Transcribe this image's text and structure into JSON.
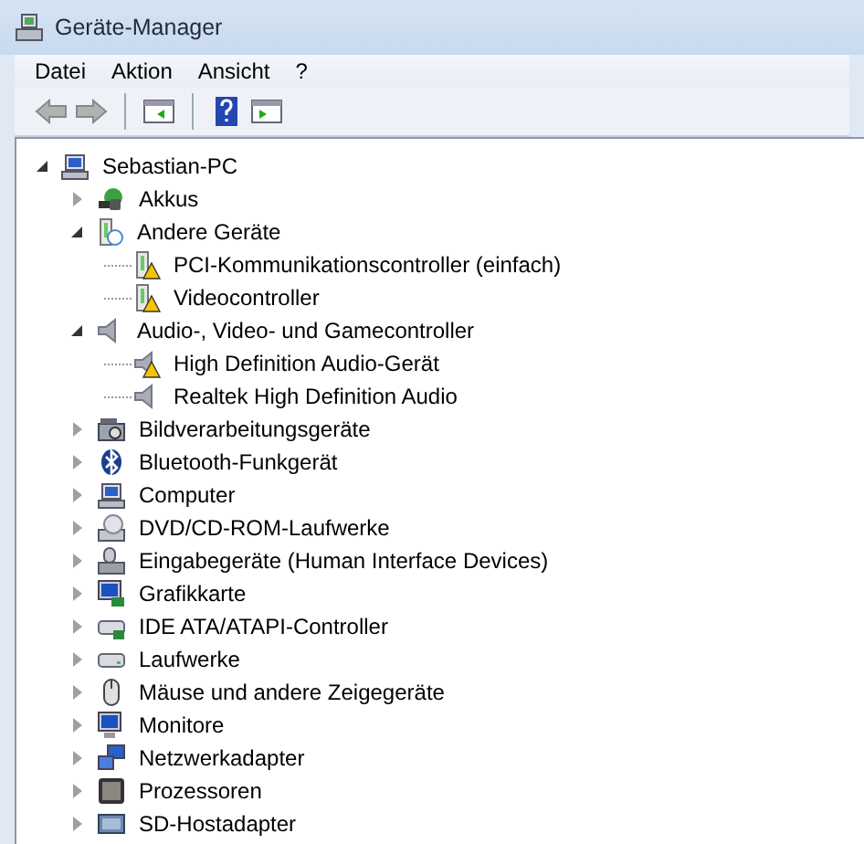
{
  "window": {
    "title": "Geräte-Manager"
  },
  "menu": [
    "Datei",
    "Aktion",
    "Ansicht",
    "?"
  ],
  "toolbar": [
    {
      "kind": "back",
      "disabled": true
    },
    {
      "kind": "forward",
      "disabled": true
    },
    {
      "kind": "separator"
    },
    {
      "kind": "console"
    },
    {
      "kind": "separator"
    },
    {
      "kind": "help"
    },
    {
      "kind": "panel"
    }
  ],
  "tree": {
    "label": "Sebastian-PC",
    "kind": "pc",
    "expanded": true,
    "children": [
      {
        "label": "Akkus",
        "kind": "battery",
        "expanded": false
      },
      {
        "label": "Andere Geräte",
        "kind": "unknown",
        "expanded": true,
        "children": [
          {
            "label": "PCI-Kommunikationscontroller (einfach)",
            "kind": "unknown",
            "warning": true
          },
          {
            "label": "Videocontroller",
            "kind": "unknown",
            "warning": true
          }
        ]
      },
      {
        "label": "Audio-, Video- und Gamecontroller",
        "kind": "speaker",
        "expanded": true,
        "children": [
          {
            "label": "High Definition Audio-Gerät",
            "kind": "speaker",
            "warning": true
          },
          {
            "label": "Realtek High Definition Audio",
            "kind": "speaker",
            "warning": false
          }
        ]
      },
      {
        "label": "Bildverarbeitungsgeräte",
        "kind": "camera",
        "expanded": false
      },
      {
        "label": "Bluetooth-Funkgerät",
        "kind": "bluetooth",
        "expanded": false
      },
      {
        "label": "Computer",
        "kind": "computer",
        "expanded": false
      },
      {
        "label": "DVD/CD-ROM-Laufwerke",
        "kind": "disc",
        "expanded": false
      },
      {
        "label": "Eingabegeräte (Human Interface Devices)",
        "kind": "input",
        "expanded": false
      },
      {
        "label": "Grafikkarte",
        "kind": "display",
        "expanded": false
      },
      {
        "label": "IDE ATA/ATAPI-Controller",
        "kind": "controller",
        "expanded": false
      },
      {
        "label": "Laufwerke",
        "kind": "drive",
        "expanded": false
      },
      {
        "label": "Mäuse und andere Zeigegeräte",
        "kind": "mouse",
        "expanded": false
      },
      {
        "label": "Monitore",
        "kind": "monitor",
        "expanded": false
      },
      {
        "label": "Netzwerkadapter",
        "kind": "network",
        "expanded": false
      },
      {
        "label": "Prozessoren",
        "kind": "cpu",
        "expanded": false
      },
      {
        "label": "SD-Hostadapter",
        "kind": "card",
        "expanded": false
      }
    ]
  }
}
